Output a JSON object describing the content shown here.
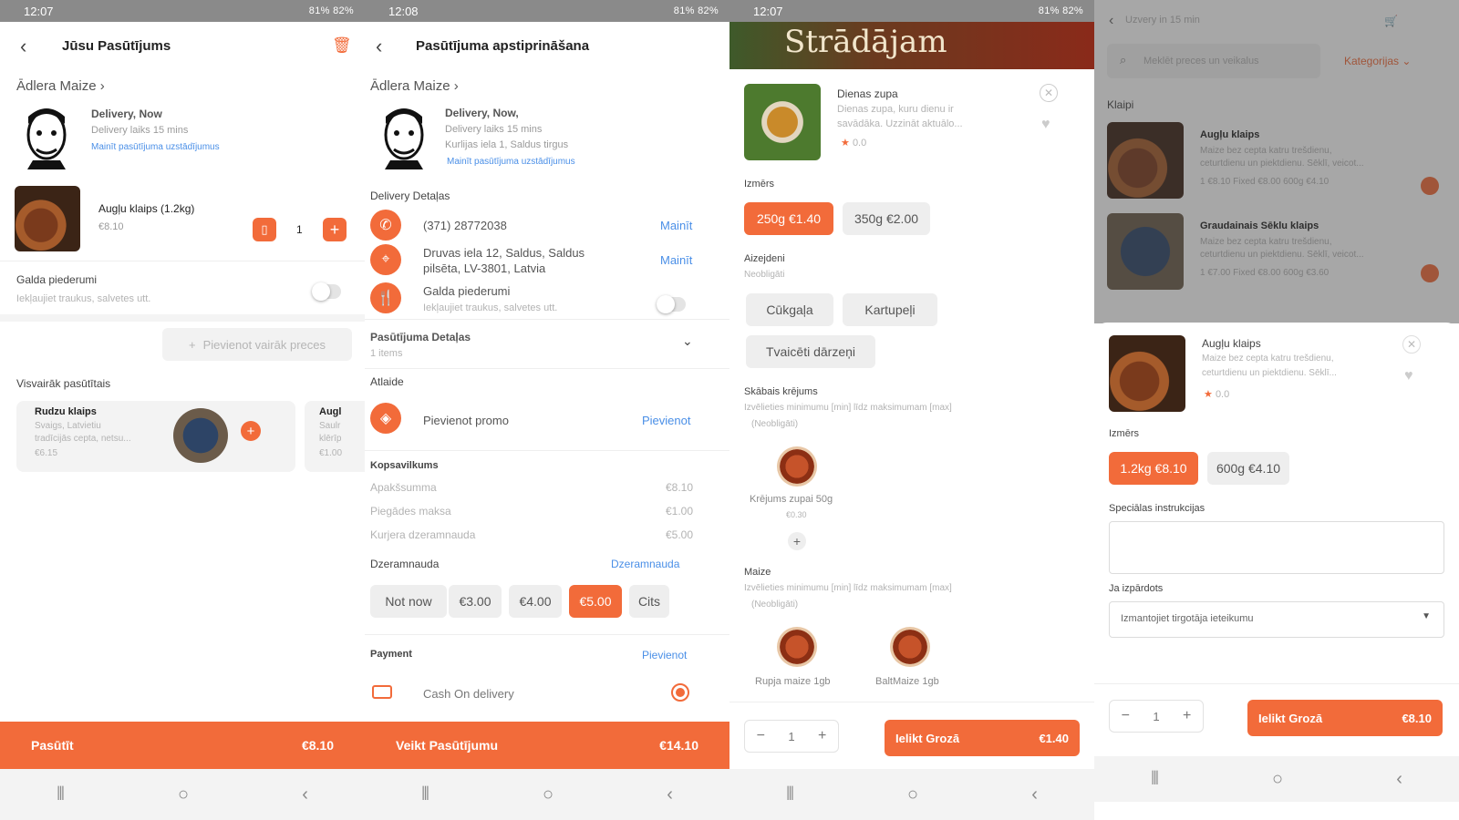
{
  "status": {
    "s1_time": "12:07",
    "s2_time": "12:08",
    "s3_time": "12:07",
    "s4_time": "",
    "battery": "81% 82%"
  },
  "s1": {
    "title": "Jūsu Pasūtījums",
    "store": "Ādlera Maize",
    "delivery": "Delivery, Now",
    "delivery_time": "Delivery laiks 15 mins",
    "change_link": "Mainīt pasūtījuma uzstādījumus",
    "item_name": "Augļu klaips (1.2kg)",
    "item_price": "€8.10",
    "qty": "1",
    "cutlery_label": "Galda piederumi",
    "cutlery_sub": "Iekļaujiet traukus, salvetes utt.",
    "add_more": "Pievienot vairāk preces",
    "popular_title": "Visvairāk pasūtītais",
    "popular_name": "Rudzu klaips",
    "popular_desc1": "Svaigs, Latvietiu",
    "popular_desc2": "tradīcijās cepta, netsu...",
    "popular_price": "€6.15",
    "popular2_name": "Augl",
    "popular2_desc1": "Saulr",
    "popular2_desc2": "klērīp",
    "popular2_price": "€1.00",
    "cta_label": "Pasūtīt",
    "cta_price": "€8.10"
  },
  "s2": {
    "title": "Pasūtījuma apstiprināšana",
    "store": "Ādlera Maize",
    "delivery": "Delivery, Now,",
    "delivery_time": "Delivery laiks 15 mins",
    "address_short": "Kurlijas iela 1, Saldus tirgus",
    "change_link": "Mainīt pasūtījuma uzstādījumus",
    "delivery_details": "Delivery Detaļas",
    "phone": "(371) 28772038",
    "phone_action": "Mainīt",
    "address": "Druvas iela 12, Saldus, Saldus",
    "address2": "pilsēta, LV-3801, Latvia",
    "address_action": "Mainīt",
    "cutlery_label": "Galda piederumi",
    "cutlery_sub": "Iekļaujiet traukus, salvetes utt.",
    "order_details": "Pasūtījuma Detaļas",
    "order_items": "1 items",
    "discount_title": "Atlaide",
    "promo": "Pievienot promo",
    "promo_action": "Pievienot",
    "summary_title": "Kopsavilkums",
    "subtotal_label": "Apakšsumma",
    "subtotal": "€8.10",
    "delivery_fee_label": "Piegādes maksa",
    "delivery_fee": "€1.00",
    "tip_row_label": "Kurjera dzeramnauda",
    "tip_row": "€5.00",
    "tip_title": "Dzeramnauda",
    "tip_link": "Dzeramnauda",
    "tips": [
      "Not now",
      "€3.00",
      "€4.00",
      "€5.00",
      "Cits"
    ],
    "payment_title": "Payment",
    "payment_action": "Pievienot",
    "payment_method": "Cash On delivery",
    "cta_label": "Veikt Pasūtījumu",
    "cta_price": "€14.10"
  },
  "s3": {
    "banner_text": "Strādājam",
    "item_name": "Dienas zupa",
    "item_desc1": "Dienas zupa, kuru dienu ir",
    "item_desc2": "savādāka. Uzzināt aktuālo...",
    "rating": "0.0",
    "size_title": "Izmērs",
    "sizes": [
      "250g €1.40",
      "350g €2.00"
    ],
    "extras_title": "Aizejdeni",
    "extras_sub": "Neobligāti",
    "extras": [
      "Cūkgaļa",
      "Kartupeļi",
      "Tvaicēti dārzeņi"
    ],
    "sauce_title": "Skābais krējums",
    "sauce_sub": "Izvēlieties minimumu [min] līdz maksimumam [max]",
    "sauce_sub2": "(Neobligāti)",
    "sauce_item": "Krējums zupai 50g",
    "sauce_price": "€0.30",
    "bread_title": "Maize",
    "bread_sub": "Izvēlieties minimumu [min] līdz maksimumam [max]",
    "bread_sub2": "(Neobligāti)",
    "bread1": "Rupja maize 1gb",
    "bread2": "BaltMaize 1gb",
    "qty": "1",
    "cta_label": "Ielikt Grozā",
    "cta_price": "€1.40"
  },
  "s4": {
    "header": "Uzvery in 15 min",
    "search_placeholder": "Meklēt preces un veikalus",
    "categories": "Kategorijas",
    "section": "Klaipi",
    "bg1_name": "Augļu klaips",
    "bg1_desc1": "Maize bez cepta katru trešdienu,",
    "bg1_desc2": "ceturtdienu un piektdienu. Sēklī, veicot...",
    "bg1_price": "1 €8.10   Fixed €8.00   600g €4.10",
    "bg2_name": "Graudainais Sēklu klaips",
    "bg2_desc1": "Maize bez cepta katru trešdienu,",
    "bg2_desc2": "ceturtdienu un piektdienu. Sēklī, veicot...",
    "bg2_price": "1 €7.00   Fixed €8.00   600g €3.60",
    "item_name": "Augļu klaips",
    "item_desc1": "Maize bez cepta katru trešdienu,",
    "item_desc2": "ceturtdienu un piektdienu. Sēklī...",
    "rating": "0.0",
    "size_title": "Izmērs",
    "sizes": [
      "1.2kg €8.10",
      "600g €4.10"
    ],
    "instructions_title": "Speciālas instrukcijas",
    "out_of_stock_title": "Ja izpārdots",
    "out_of_stock_value": "Izmantojiet tirgotāja ieteikumu",
    "qty": "1",
    "cta_label": "Ielikt Grozā",
    "cta_price": "€8.10"
  }
}
